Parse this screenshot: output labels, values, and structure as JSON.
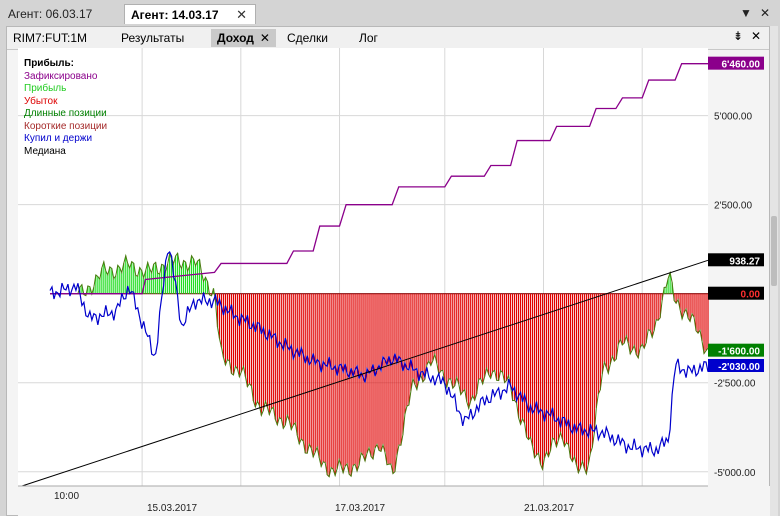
{
  "doc_tabs": [
    {
      "label": "Агент: 06.03.17"
    },
    {
      "label": "Агент: 14.03.17"
    }
  ],
  "window_controls": {
    "dropdown": "▼",
    "close": "✕"
  },
  "sub_tabs": [
    {
      "label": "RIM7:FUT:1M"
    },
    {
      "label": "Результаты"
    },
    {
      "label": "Доход"
    },
    {
      "label": "Сделки"
    },
    {
      "label": "Лог"
    }
  ],
  "legend": {
    "title": "Прибыль:",
    "items": [
      {
        "label": "Зафиксировано",
        "color": "#8b008b"
      },
      {
        "label": "Прибыль",
        "color": "#22cc22"
      },
      {
        "label": "Убыток",
        "color": "#dd0000"
      },
      {
        "label": "Длинные позиции",
        "color": "#008000"
      },
      {
        "label": "Короткие позиции",
        "color": "#a52a2a"
      },
      {
        "label": "Купил и держи",
        "color": "#0000cc"
      },
      {
        "label": "Медиана",
        "color": "#000000"
      }
    ]
  },
  "chart_data": {
    "type": "area",
    "x_tick_labels": [
      "10:00",
      "15.03.2017",
      "17.03.2017",
      "21.03.2017"
    ],
    "y_ticks": [
      5000,
      2500,
      -2500,
      -5000
    ],
    "y_tick_labels": [
      "5'000.00",
      "2'500.00",
      "-2'500.00",
      "-5'000.00"
    ],
    "ylim": [
      -5400,
      6900
    ],
    "value_labels": [
      {
        "text": "6'460.00",
        "value": 6460,
        "bg": "#8b008b",
        "fg": "#ffffff"
      },
      {
        "text": "938.27",
        "value": 938.27,
        "bg": "#000000",
        "fg": "#ffffff"
      },
      {
        "text": "0.00",
        "value": 0,
        "bg": "#000000",
        "fg": "#ff3030"
      },
      {
        "text": "-1'600.00",
        "value": -1600,
        "bg": "#008000",
        "fg": "#ffffff"
      },
      {
        "text": "-2'030.00",
        "value": -2030,
        "bg": "#0000cc",
        "fg": "#ffffff"
      }
    ],
    "grid": true,
    "series": [
      {
        "name": "Зафиксировано",
        "color": "#8b008b",
        "x": [
          0,
          0.14,
          0.145,
          0.25,
          0.26,
          0.36,
          0.37,
          0.4,
          0.41,
          0.44,
          0.45,
          0.52,
          0.53,
          0.6,
          0.61,
          0.66,
          0.67,
          0.7,
          0.71,
          0.76,
          0.77,
          0.82,
          0.83,
          0.86,
          0.87,
          0.9,
          0.91,
          0.95,
          0.96,
          1.0
        ],
        "values": [
          0,
          0,
          400,
          600,
          850,
          850,
          1200,
          1200,
          1900,
          1900,
          2500,
          2500,
          3000,
          3000,
          3300,
          3300,
          3600,
          3600,
          4300,
          4300,
          4700,
          4700,
          5200,
          5200,
          5500,
          5500,
          6000,
          6000,
          6460,
          6460
        ]
      },
      {
        "name": "Прибыль / Убыток",
        "color": "#22cc22",
        "x": [
          0,
          0.05,
          0.08,
          0.12,
          0.15,
          0.18,
          0.22,
          0.25,
          0.26,
          0.29,
          0.32,
          0.36,
          0.4,
          0.43,
          0.47,
          0.5,
          0.52,
          0.55,
          0.58,
          0.61,
          0.64,
          0.67,
          0.7,
          0.73,
          0.75,
          0.78,
          0.8,
          0.82,
          0.84,
          0.87,
          0.9,
          0.92,
          0.94,
          0.95,
          0.97,
          1.0
        ],
        "values": [
          0,
          0,
          600,
          800,
          600,
          900,
          900,
          0,
          -1800,
          -2200,
          -3200,
          -3600,
          -4500,
          -5000,
          -4800,
          -4200,
          -5100,
          -2700,
          -1900,
          -2500,
          -3000,
          -2100,
          -2600,
          -4300,
          -4700,
          -3900,
          -5000,
          -4700,
          -2200,
          -1400,
          -1600,
          -900,
          500,
          -200,
          -600,
          -1600
        ]
      },
      {
        "name": "Купил и держи",
        "color": "#0000cc",
        "x": [
          0,
          0.04,
          0.06,
          0.1,
          0.12,
          0.14,
          0.16,
          0.18,
          0.2,
          0.22,
          0.25,
          0.28,
          0.32,
          0.36,
          0.4,
          0.44,
          0.48,
          0.52,
          0.56,
          0.6,
          0.63,
          0.66,
          0.7,
          0.73,
          0.76,
          0.8,
          0.84,
          0.88,
          0.92,
          0.94,
          0.95,
          0.97,
          1.0
        ],
        "values": [
          0,
          200,
          -700,
          -500,
          200,
          -800,
          -1800,
          1500,
          -900,
          -200,
          -200,
          -600,
          -1000,
          -1500,
          -1900,
          -2100,
          -2300,
          -1800,
          -2200,
          -2500,
          -3600,
          -3000,
          -2600,
          -3200,
          -3400,
          -3800,
          -3900,
          -4300,
          -4400,
          -4100,
          -2000,
          -2200,
          -2030
        ]
      },
      {
        "name": "Медиана",
        "color": "#000000",
        "x": [
          -0.0,
          1.0
        ],
        "values": [
          -5400,
          938.27
        ]
      }
    ]
  }
}
